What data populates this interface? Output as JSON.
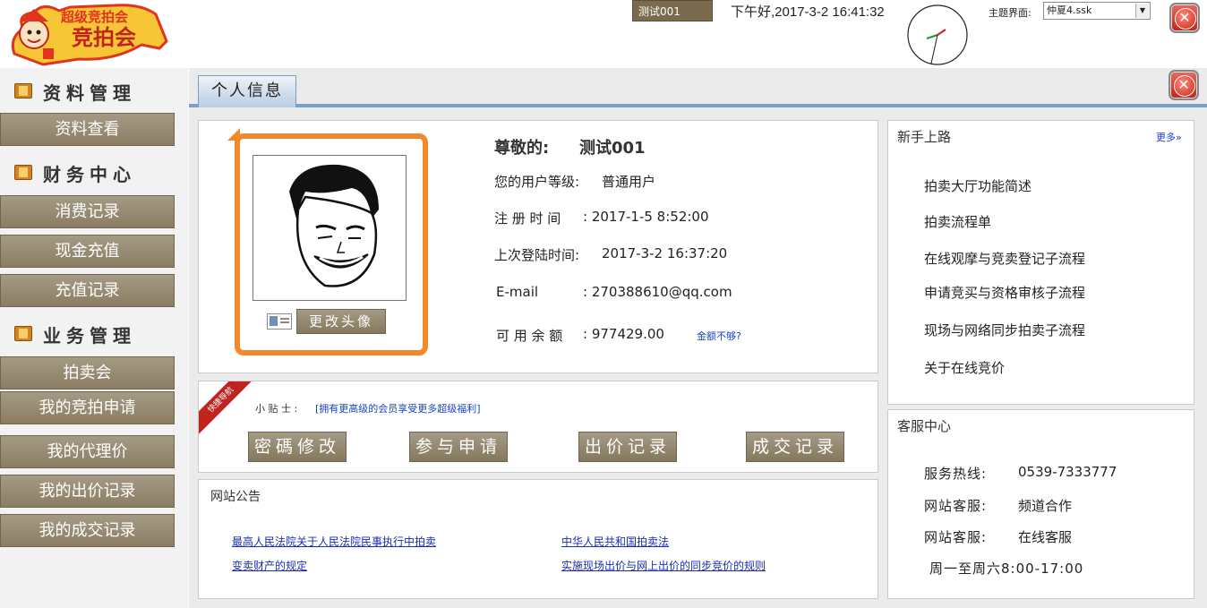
{
  "header": {
    "logo_text": "超级竞拍会",
    "user_tab": "测试001",
    "greeting": "下午好,2017-3-2 16:41:32",
    "theme_label": "主题界面:",
    "theme_value": "仲夏4.ssk"
  },
  "sidebar": {
    "sections": [
      {
        "title": "资料管理",
        "items": [
          "资料查看"
        ]
      },
      {
        "title": "财务中心",
        "items": [
          "消费记录",
          "现金充值",
          "充值记录"
        ]
      },
      {
        "title": "业务管理",
        "items": [
          "拍卖会",
          "我的竞拍申请",
          "我的代理价",
          "我的出价记录",
          "我的成交记录"
        ]
      }
    ]
  },
  "main": {
    "tab_label": "个人信息",
    "profile": {
      "greeting_prefix": "尊敬的:",
      "username": "测试001",
      "level_label": "您的用户等级:",
      "level_value": "普通用户",
      "reg_label": "注 册 时 间",
      "reg_value": ":  2017-1-5 8:52:00",
      "last_label": "上次登陆时间:",
      "last_value": "2017-3-2 16:37:20",
      "email_label": "E-mail",
      "email_value": ":  270388610@qq.com",
      "balance_label": "可 用 余 额",
      "balance_value": ":  977429.00",
      "balance_link": "金额不够?",
      "change_avatar": "更改头像"
    },
    "quick": {
      "ribbon": "快捷导航",
      "tips_label": "小 贴 士 :",
      "tips_text": "[拥有更高级的会员享受更多超级福利]",
      "buttons": [
        "密碼修改",
        "参与申请",
        "出价记录",
        "成交记录"
      ]
    },
    "notice": {
      "title": "网站公告",
      "links": [
        "最高人民法院关于人民法院民事执行中拍卖",
        "中华人民共和国拍卖法",
        "变卖财产的规定",
        "实施现场出价与网上出价的同步竞价的规则"
      ]
    },
    "newbie": {
      "title": "新手上路",
      "more": "更多»",
      "items": [
        "拍卖大厅功能简述",
        "拍卖流程单",
        "在线观摩与竞卖登记子流程",
        "申请竞买与资格审核子流程",
        "现场与网络同步拍卖子流程",
        "关于在线竞价"
      ]
    },
    "service": {
      "title": "客服中心",
      "rows": [
        {
          "label": "服务热线:",
          "value": "0539-7333777"
        },
        {
          "label": "网站客服:",
          "value": "频道合作"
        },
        {
          "label": "网站客服:",
          "value": "在线客服"
        }
      ],
      "hours": "周一至周六8:00-17:00"
    }
  },
  "colors": {
    "nav_button": "#978b71",
    "avatar_frame": "#f08a2a",
    "close_red": "#c1241a",
    "tab_blue": "#79a1c9"
  },
  "icons": [
    "close-icon",
    "book-icon",
    "card-icon",
    "clock-icon"
  ]
}
